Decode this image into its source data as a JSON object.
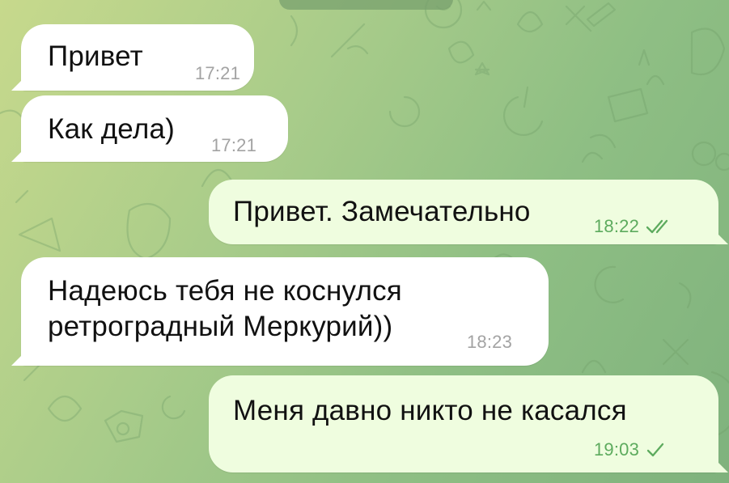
{
  "colors": {
    "incoming_bubble": "#ffffff",
    "outgoing_bubble": "#effddf",
    "incoming_time": "#a3a3a3",
    "outgoing_time_and_check": "#5dab5e"
  },
  "messages": [
    {
      "direction": "incoming",
      "text": "Привет",
      "time": "17:21"
    },
    {
      "direction": "incoming",
      "text": "Как дела)",
      "time": "17:21"
    },
    {
      "direction": "outgoing",
      "text": "Привет. Замечательно",
      "time": "18:22",
      "status_icon": "double-check-icon"
    },
    {
      "direction": "incoming",
      "text": "Надеюсь тебя не коснулся\nретроградный Меркурий))",
      "time": "18:23"
    },
    {
      "direction": "outgoing",
      "text": "Меня давно никто не касался",
      "time": "19:03",
      "status_icon": "single-check-icon"
    }
  ]
}
